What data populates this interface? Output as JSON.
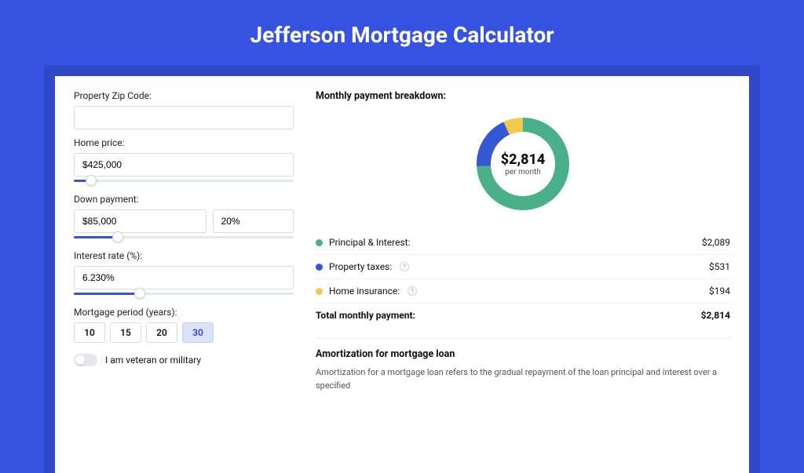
{
  "title": "Jefferson Mortgage Calculator",
  "form": {
    "zip_label": "Property Zip Code:",
    "zip_value": "",
    "home_price_label": "Home price:",
    "home_price_value": "$425,000",
    "home_price_slider_pct": 8,
    "down_label": "Down payment:",
    "down_value": "$85,000",
    "down_pct_value": "20%",
    "down_slider_pct": 20,
    "rate_label": "Interest rate (%):",
    "rate_value": "6.230%",
    "rate_slider_pct": 30,
    "period_label": "Mortgage period (years):",
    "periods": [
      "10",
      "15",
      "20",
      "30"
    ],
    "period_selected": "30",
    "veteran_label": "I am veteran or military",
    "veteran_on": false
  },
  "breakdown": {
    "title": "Monthly payment breakdown:",
    "center_value": "$2,814",
    "center_sub": "per month",
    "items": [
      {
        "label": "Principal & Interest:",
        "value": "$2,089",
        "color": "#4ab08a",
        "pct": 74,
        "info": false
      },
      {
        "label": "Property taxes:",
        "value": "$531",
        "color": "#3457d6",
        "pct": 19,
        "info": true
      },
      {
        "label": "Home insurance:",
        "value": "$194",
        "color": "#f1c94e",
        "pct": 7,
        "info": true
      }
    ],
    "total_label": "Total monthly payment:",
    "total_value": "$2,814"
  },
  "amort": {
    "title": "Amortization for mortgage loan",
    "text": "Amortization for a mortgage loan refers to the gradual repayment of the loan principal and interest over a specified"
  }
}
